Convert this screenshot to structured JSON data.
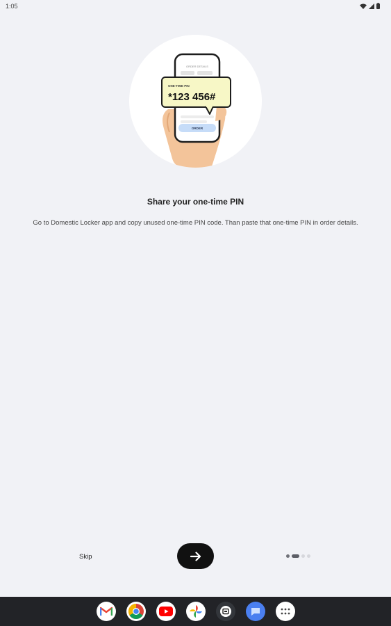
{
  "status_bar": {
    "time": "1:05",
    "icons": [
      "wifi-icon",
      "signal-icon",
      "battery-icon"
    ]
  },
  "illustration": {
    "phone_header": "ORDER DETAILS",
    "pin_label": "ONE-TIME PIN",
    "pin_code": "*123 456#",
    "order_button": "ORDER"
  },
  "content": {
    "title": "Share your one-time PIN",
    "description": "Go to Domestic Locker app and copy unused one-time PIN code. Than paste that one-time PIN in order details."
  },
  "controls": {
    "skip_label": "Skip",
    "next_icon": "arrow-right-icon",
    "page_indicator": {
      "total": 4,
      "current": 2
    }
  },
  "dock": {
    "apps": [
      "gmail-icon",
      "chrome-icon",
      "youtube-icon",
      "photos-icon",
      "screen-recorder-icon",
      "messages-icon",
      "app-drawer-icon"
    ]
  },
  "colors": {
    "background": "#f1f2f6",
    "primary_button": "#111111",
    "pin_card": "#f7f7c6",
    "nav_bar": "#222327"
  }
}
